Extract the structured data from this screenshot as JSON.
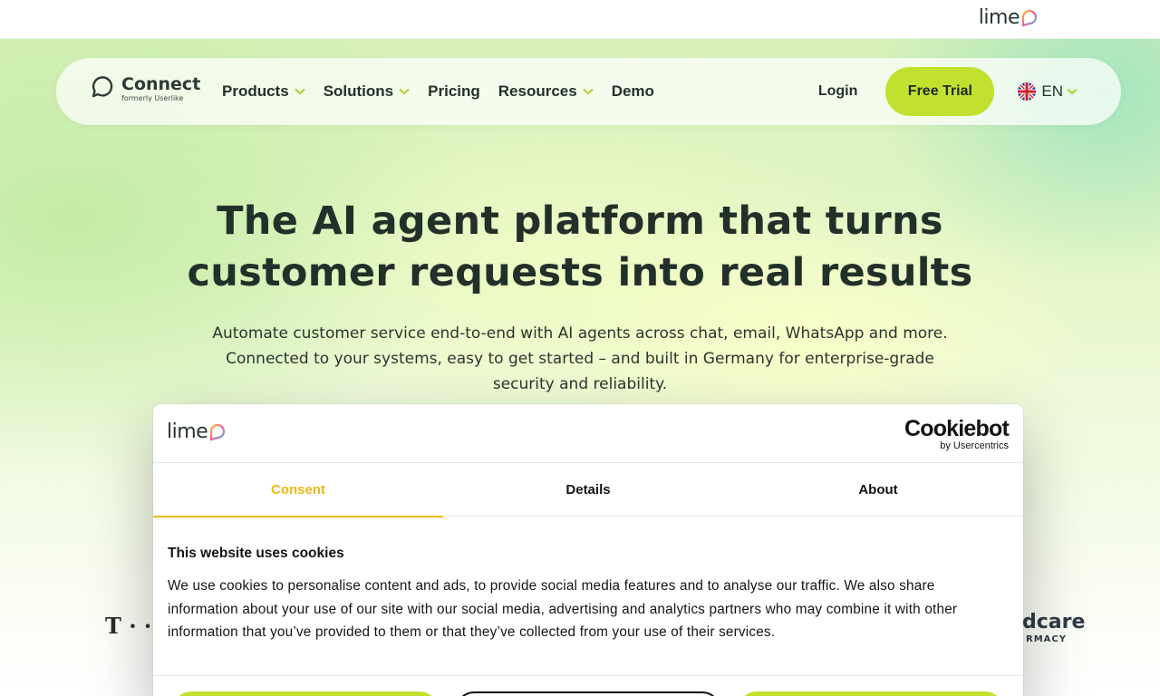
{
  "topbar": {
    "logo_text": "lime"
  },
  "nav": {
    "brand_name": "Connect",
    "brand_sub": "formerly Userlike",
    "items": [
      {
        "label": "Products",
        "has_dropdown": true
      },
      {
        "label": "Solutions",
        "has_dropdown": true
      },
      {
        "label": "Pricing",
        "has_dropdown": false
      },
      {
        "label": "Resources",
        "has_dropdown": true
      },
      {
        "label": "Demo",
        "has_dropdown": false
      }
    ],
    "login": "Login",
    "free_trial": "Free Trial",
    "language": "EN"
  },
  "hero": {
    "title_line1": "The AI agent platform that turns",
    "title_line2": "customer requests into real results",
    "sub_line1": "Automate customer service end-to-end with AI agents across chat, email, WhatsApp and more.",
    "sub_line2": "Connected to your systems, easy to get started – and built in Germany for enterprise-grade",
    "sub_line3": "security and reliability."
  },
  "partners": {
    "left": "T · · S",
    "right_big": "dcare",
    "right_small": "RMACY"
  },
  "cookie_modal": {
    "logo_text": "lime",
    "provider_main": "Cookiebot",
    "provider_sub": "by Usercentrics",
    "tabs": [
      "Consent",
      "Details",
      "About"
    ],
    "active_tab": "Consent",
    "title": "This website uses cookies",
    "body": "We use cookies to personalise content and ads, to provide social media features and to analyse our traffic. We also share information about your use of our site with our social media, advertising and analytics partners who may combine it with other information that you’ve provided to them or that they’ve collected from your use of their services."
  },
  "colors": {
    "accent_lime": "#c2e12e",
    "active_tab": "#f0b81a",
    "text_dark": "#22302a"
  }
}
